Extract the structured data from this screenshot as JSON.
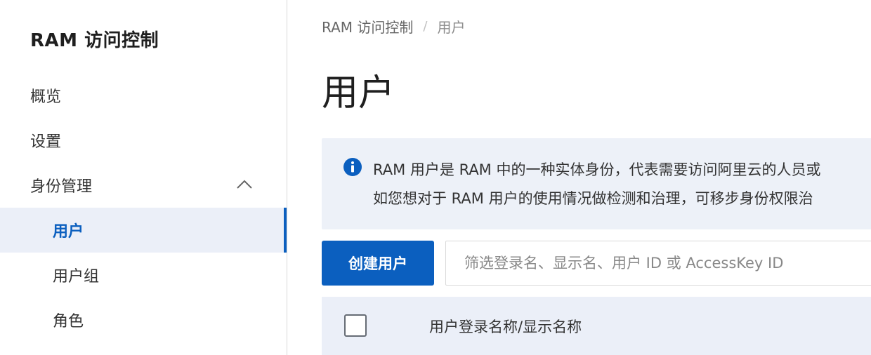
{
  "sidebar": {
    "title": "RAM 访问控制",
    "items": [
      {
        "label": "概览"
      },
      {
        "label": "设置"
      },
      {
        "label": "身份管理"
      },
      {
        "label": "用户"
      },
      {
        "label": "用户组"
      },
      {
        "label": "角色"
      }
    ]
  },
  "breadcrumb": {
    "root": "RAM 访问控制",
    "separator": "/",
    "current": "用户"
  },
  "page": {
    "title": "用户"
  },
  "notice": {
    "icon": "info-icon",
    "line1": "RAM 用户是 RAM 中的一种实体身份，代表需要访问阿里云的人员或",
    "line2": "如您想对于 RAM 用户的使用情况做检测和治理，可移步身份权限治"
  },
  "toolbar": {
    "create_label": "创建用户",
    "search_placeholder": "筛选登录名、显示名、用户 ID 或 AccessKey ID"
  },
  "table": {
    "columns": [
      "用户登录名称/显示名称"
    ]
  },
  "colors": {
    "accent": "#0b5fbf",
    "active_bg": "#ebeff8",
    "notice_bg": "#edf1f8"
  }
}
